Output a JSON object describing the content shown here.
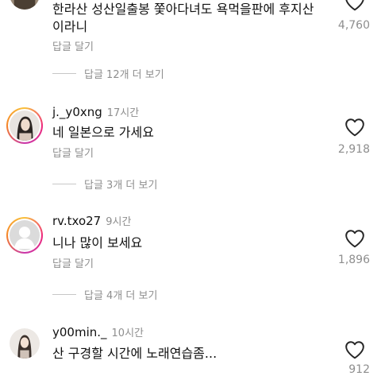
{
  "comments": [
    {
      "username": "",
      "time": "",
      "text_line1": "한라산 성산일출봉 쫓아다녀도 욕먹을판에 후지산",
      "text_line2": "이라니",
      "reply_label": "답글 달기",
      "likes": "4,760",
      "view_replies": "답글 12개 더 보기"
    },
    {
      "username": "j._y0xng",
      "time": "17시간",
      "text": "네 일본으로 가세요",
      "reply_label": "답글 달기",
      "likes": "2,918",
      "view_replies": "답글 3개 더 보기"
    },
    {
      "username": "rv.txo27",
      "time": "9시간",
      "text": "니나 많이 보세요",
      "reply_label": "답글 달기",
      "likes": "1,896",
      "view_replies": "답글 4개 더 보기"
    },
    {
      "username": "y00min._",
      "time": "10시간",
      "text": "산 구경할 시간에 노래연습좀...",
      "likes": "912"
    }
  ],
  "colors": {
    "heart_outline": "#262626",
    "meta_gray": "#8e8e8e"
  },
  "icons": {
    "like": "heart-outline-icon",
    "avatar_default": "default-avatar-icon"
  }
}
